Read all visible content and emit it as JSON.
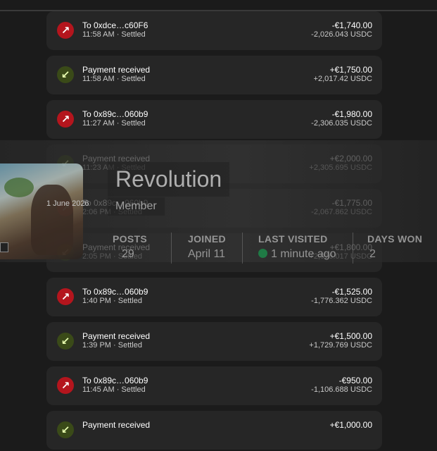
{
  "transactions": [
    {
      "type": "out",
      "title": "To 0xdce…c60F6",
      "time": "11:58 AM · Settled",
      "amount": "-€1,740.00",
      "usdc": "-2,026.043 USDC"
    },
    {
      "type": "in",
      "title": "Payment received",
      "time": "11:58 AM · Settled",
      "amount": "+€1,750.00",
      "usdc": "+2,017.42 USDC"
    },
    {
      "type": "out",
      "title": "To 0x89c…060b9",
      "time": "11:27 AM · Settled",
      "amount": "-€1,980.00",
      "usdc": "-2,306.035 USDC"
    },
    {
      "type": "in",
      "title": "Payment received",
      "time": "11:23 AM · Settled",
      "amount": "+€2,000.00",
      "usdc": "+2,305.695 USDC"
    },
    {
      "type": "out",
      "title": "To 0x89c…060b9",
      "time": "2:06 PM · Settled",
      "amount": "-€1,775.00",
      "usdc": "-2,067.862 USDC"
    },
    {
      "type": "in",
      "title": "Payment received",
      "time": "2:05 PM · Settled",
      "amount": "+€1,800.00",
      "usdc": "+2,076.017 USDC"
    },
    {
      "type": "out",
      "title": "To 0x89c…060b9",
      "time": "1:40 PM · Settled",
      "amount": "-€1,525.00",
      "usdc": "-1,776.362 USDC"
    },
    {
      "type": "in",
      "title": "Payment received",
      "time": "1:39 PM · Settled",
      "amount": "+€1,500.00",
      "usdc": "+1,729.769 USDC"
    },
    {
      "type": "out",
      "title": "To 0x89c…060b9",
      "time": "11:45 AM · Settled",
      "amount": "-€950.00",
      "usdc": "-1,106.688 USDC"
    },
    {
      "type": "in",
      "title": "Payment received",
      "time": "",
      "amount": "+€1,000.00",
      "usdc": ""
    }
  ],
  "icons": {
    "out": "arrow-up-right-icon",
    "in": "arrow-down-left-icon"
  },
  "colors": {
    "out": "#b4151d",
    "in": "#3a4a18",
    "card": "#262626",
    "background": "#1b1b1b"
  },
  "profile": {
    "name": "Revolution",
    "role": "Member",
    "date": "1 June 2026",
    "stats": {
      "posts_label": "POSTS",
      "posts_value": "29",
      "joined_label": "JOINED",
      "joined_value": "April 11",
      "last_visited_label": "LAST VISITED",
      "last_visited_value": "1 minute ago",
      "days_won_label": "DAYS WON",
      "days_won_value": "2"
    }
  }
}
